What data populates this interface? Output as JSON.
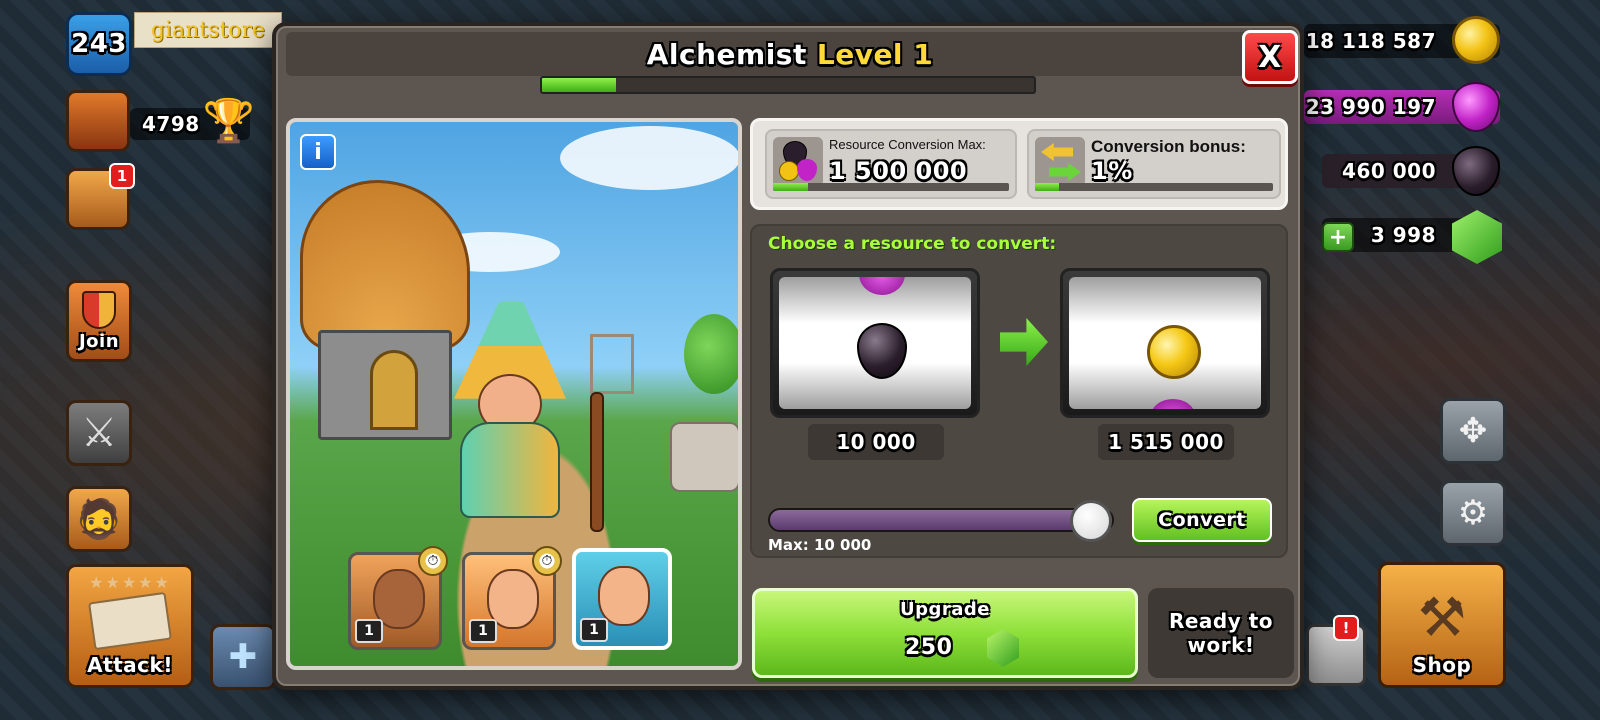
{
  "hud": {
    "xp_level": "243",
    "brand_text": "giantstore",
    "trophies": "4798",
    "events_badge": "1",
    "join_label": "Join",
    "attack_label": "Attack!",
    "shop_label": "Shop",
    "news_badge": "!"
  },
  "resources": {
    "gold": "18 118 587",
    "elixir": "23 990 197",
    "dark_elixir": "460 000",
    "gems": "3 998"
  },
  "modal": {
    "title": "Alchemist",
    "level": "Level 1",
    "close_label": "X",
    "xp_progress": 0.15
  },
  "workers": [
    {
      "level": "1",
      "busy": true
    },
    {
      "level": "1",
      "busy": true
    },
    {
      "level": "1",
      "busy": false,
      "selected": true
    }
  ],
  "stats": {
    "max_label": "Resource Conversion Max:",
    "max_value": "1 500 000",
    "max_progress": 0.15,
    "bonus_label": "Conversion bonus:",
    "bonus_value": "1%",
    "bonus_progress": 0.1
  },
  "convert": {
    "title": "Choose a resource to convert:",
    "from_resource": "dark-elixir",
    "to_resource": "gold",
    "from_amount": "10 000",
    "to_amount": "1 515 000",
    "slider_value": 1.0,
    "max_label": "Max: 10 000",
    "button_label": "Convert"
  },
  "upgrade": {
    "label": "Upgrade",
    "cost": "250",
    "cost_currency": "gem-icon"
  },
  "status": {
    "text": "Ready to work!"
  },
  "colors": {
    "accent_green": "#62c022",
    "title_yellow": "#ffd83a",
    "close_red": "#c21212"
  }
}
